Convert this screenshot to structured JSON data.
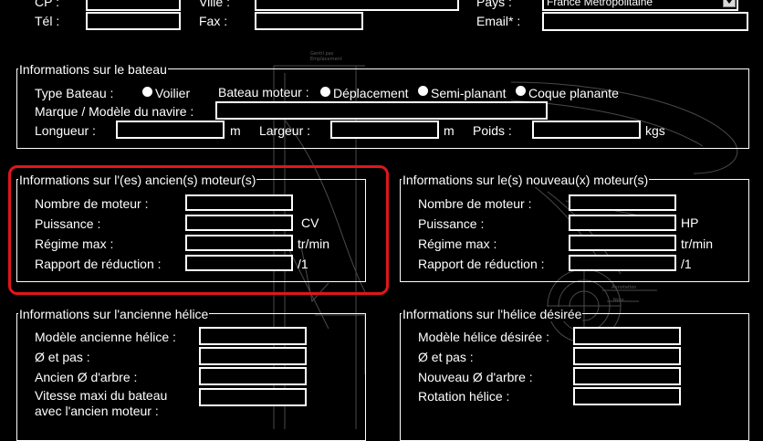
{
  "contact": {
    "cp_label": "CP :",
    "ville_label": "Ville :",
    "pays_label": "Pays :",
    "pays_value": "France Métropolitaine",
    "tel_label": "Tél :",
    "fax_label": "Fax :",
    "email_label": "Email* :"
  },
  "bateau": {
    "legend": "Informations sur le bateau",
    "type_label": "Type Bateau :",
    "voilier": "Voilier",
    "bateau_moteur_label": "Bateau moteur :",
    "deplacement": "Déplacement",
    "semi_planant": "Semi-planant",
    "coque_planante": "Coque planante",
    "marque_label": "Marque / Modèle du navire :",
    "longueur_label": "Longueur :",
    "longueur_unit": "m",
    "largeur_label": "Largeur :",
    "largeur_unit": "m",
    "poids_label": "Poids :",
    "poids_unit": "kgs"
  },
  "ancien_moteur": {
    "legend": "Informations sur l'(es) ancien(s) moteur(s)",
    "nombre_label": "Nombre de moteur :",
    "puissance_label": "Puissance :",
    "puissance_unit": "CV",
    "regime_label": "Régime max :",
    "regime_unit": "tr/min",
    "rapport_label": "Rapport de réduction :",
    "rapport_unit": "/1"
  },
  "nouveau_moteur": {
    "legend": "Informations sur le(s) nouveau(x) moteur(s)",
    "nombre_label": "Nombre de moteur :",
    "puissance_label": "Puissance :",
    "puissance_unit": "HP",
    "regime_label": "Régime max :",
    "regime_unit": "tr/min",
    "rapport_label": "Rapport de réduction :",
    "rapport_unit": "/1"
  },
  "ancienne_helice": {
    "legend": "Informations sur l'ancienne hélice",
    "modele_label": "Modèle ancienne hélice :",
    "pas_label": "Ø et pas :",
    "arbre_label": "Ancien Ø d'arbre :",
    "vitesse_label_1": "Vitesse maxi du bateau",
    "vitesse_label_2": "avec l'ancien moteur :"
  },
  "helice_desiree": {
    "legend": "Informations sur l'hélice désirée",
    "modele_label": "Modèle hélice désirée :",
    "pas_label": "Ø et pas :",
    "arbre_label": "Nouveau Ø d'arbre :",
    "rotation_label": "Rotation hélice :"
  },
  "colors": {
    "background": "#000000",
    "text": "#ffffff",
    "highlight": "#e0161b",
    "sketch": "#5a5a5a"
  }
}
